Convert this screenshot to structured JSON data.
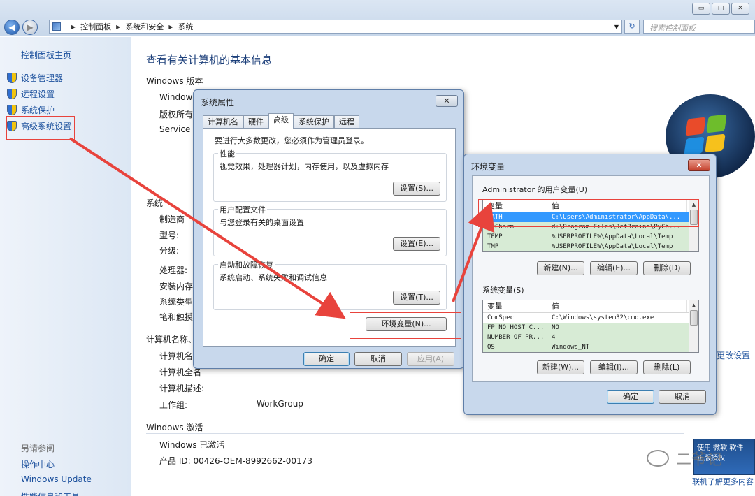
{
  "titlebar": {
    "minimize": "▭",
    "maximize": "▢",
    "close": "✕"
  },
  "nav": {
    "back": "◀",
    "forward": "▶",
    "breadcrumb": [
      "控制面板",
      "系统和安全",
      "系统"
    ],
    "search_placeholder": "搜索控制面板"
  },
  "sidebar": {
    "home": "控制面板主页",
    "items": [
      {
        "label": "设备管理器"
      },
      {
        "label": "远程设置"
      },
      {
        "label": "系统保护"
      },
      {
        "label": "高级系统设置"
      }
    ],
    "see_also": "另请参阅",
    "see_also_links": [
      "操作中心",
      "Windows Update",
      "性能信息和工具"
    ]
  },
  "main": {
    "title": "查看有关计算机的基本信息",
    "edition_heading": "Windows 版本",
    "edition_rows": [
      "Windows",
      "版权所有",
      "Service P"
    ],
    "system_heading": "系统",
    "system_rows": [
      "制造商",
      "型号:",
      "分级:",
      "处理器:",
      "安装内存(",
      "系统类型:",
      "笔和触摸:"
    ],
    "computer_heading": "计算机名称、",
    "computer_rows": [
      "计算机名:",
      "计算机全名",
      "计算机描述:",
      "工作组:"
    ],
    "workgroup_value": "WorkGroup",
    "change_settings": "更改设置",
    "activation_heading": "Windows 激活",
    "activation_status": "Windows 已激活",
    "product_id": "产品 ID: 00426-OEM-8992662-00173",
    "genuine_text": "使用 微软 软件 正版授权",
    "genuine_link": "联机了解更多内容",
    "watermark": "二爷记"
  },
  "sysprops": {
    "title": "系统属性",
    "tabs": [
      "计算机名",
      "硬件",
      "高级",
      "系统保护",
      "远程"
    ],
    "intro": "要进行大多数更改，您必须作为管理员登录。",
    "perf_title": "性能",
    "perf_desc": "视觉效果，处理器计划，内存使用，以及虚拟内存",
    "perf_btn": "设置(S)...",
    "profile_title": "用户配置文件",
    "profile_desc": "与您登录有关的桌面设置",
    "profile_btn": "设置(E)...",
    "startup_title": "启动和故障恢复",
    "startup_desc": "系统启动、系统失败和调试信息",
    "startup_btn": "设置(T)...",
    "env_btn": "环境变量(N)...",
    "ok": "确定",
    "cancel": "取消",
    "apply": "应用(A)"
  },
  "envvars": {
    "title": "环境变量",
    "user_label": "Administrator 的用户变量(U)",
    "col_var": "变量",
    "col_val": "值",
    "user_rows": [
      {
        "name": "PATH",
        "value": "C:\\Users\\Administrator\\AppData\\..."
      },
      {
        "name": "PyCharm",
        "value": "d:\\Program Files\\JetBrains\\PyCh..."
      },
      {
        "name": "TEMP",
        "value": "%USERPROFILE%\\AppData\\Local\\Temp"
      },
      {
        "name": "TMP",
        "value": "%USERPROFILE%\\AppData\\Local\\Temp"
      }
    ],
    "user_new": "新建(N)...",
    "user_edit": "编辑(E)...",
    "user_delete": "删除(D)",
    "sys_label": "系统变量(S)",
    "sys_rows": [
      {
        "name": "ComSpec",
        "value": "C:\\Windows\\system32\\cmd.exe"
      },
      {
        "name": "FP_NO_HOST_C...",
        "value": "NO"
      },
      {
        "name": "NUMBER_OF_PR...",
        "value": "4"
      },
      {
        "name": "OS",
        "value": "Windows_NT"
      }
    ],
    "sys_new": "新建(W)...",
    "sys_edit": "编辑(I)...",
    "sys_delete": "删除(L)",
    "ok": "确定",
    "cancel": "取消"
  }
}
